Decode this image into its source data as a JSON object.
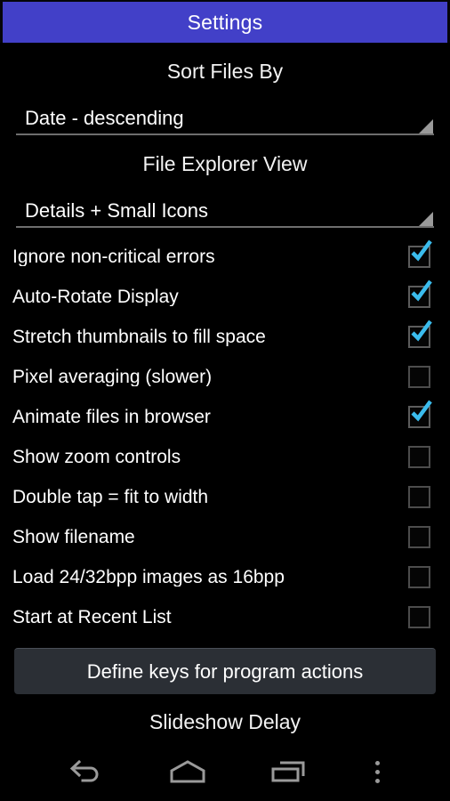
{
  "window": {
    "title": "Settings",
    "accent_color": "#4240c8",
    "background_color": "#000000",
    "checkbox_check_color": "#3bbced"
  },
  "sort_section": {
    "label": "Sort Files By",
    "spinner": {
      "value": "Date - descending",
      "arrow_icon": "dropdown-triangle-icon"
    }
  },
  "view_section": {
    "label": "File Explorer View",
    "spinner": {
      "value": "Details + Small Icons",
      "arrow_icon": "dropdown-triangle-icon"
    }
  },
  "options": [
    {
      "label": "Ignore non-critical errors",
      "checked": true
    },
    {
      "label": "Auto-Rotate Display",
      "checked": true
    },
    {
      "label": "Stretch thumbnails to fill space",
      "checked": true
    },
    {
      "label": "Pixel averaging (slower)",
      "checked": false
    },
    {
      "label": "Animate files in browser",
      "checked": true
    },
    {
      "label": "Show zoom controls",
      "checked": false
    },
    {
      "label": "Double tap = fit to width",
      "checked": false
    },
    {
      "label": "Show filename",
      "checked": false
    },
    {
      "label": "Load 24/32bpp images as 16bpp",
      "checked": false
    },
    {
      "label": "Start at Recent List",
      "checked": false
    }
  ],
  "define_keys_button": {
    "label": "Define keys for program actions"
  },
  "slideshow_section": {
    "label": "Slideshow Delay"
  },
  "navbar": {
    "back": "back-icon",
    "home": "home-icon",
    "recents": "recents-icon",
    "menu": "overflow-menu-icon"
  }
}
